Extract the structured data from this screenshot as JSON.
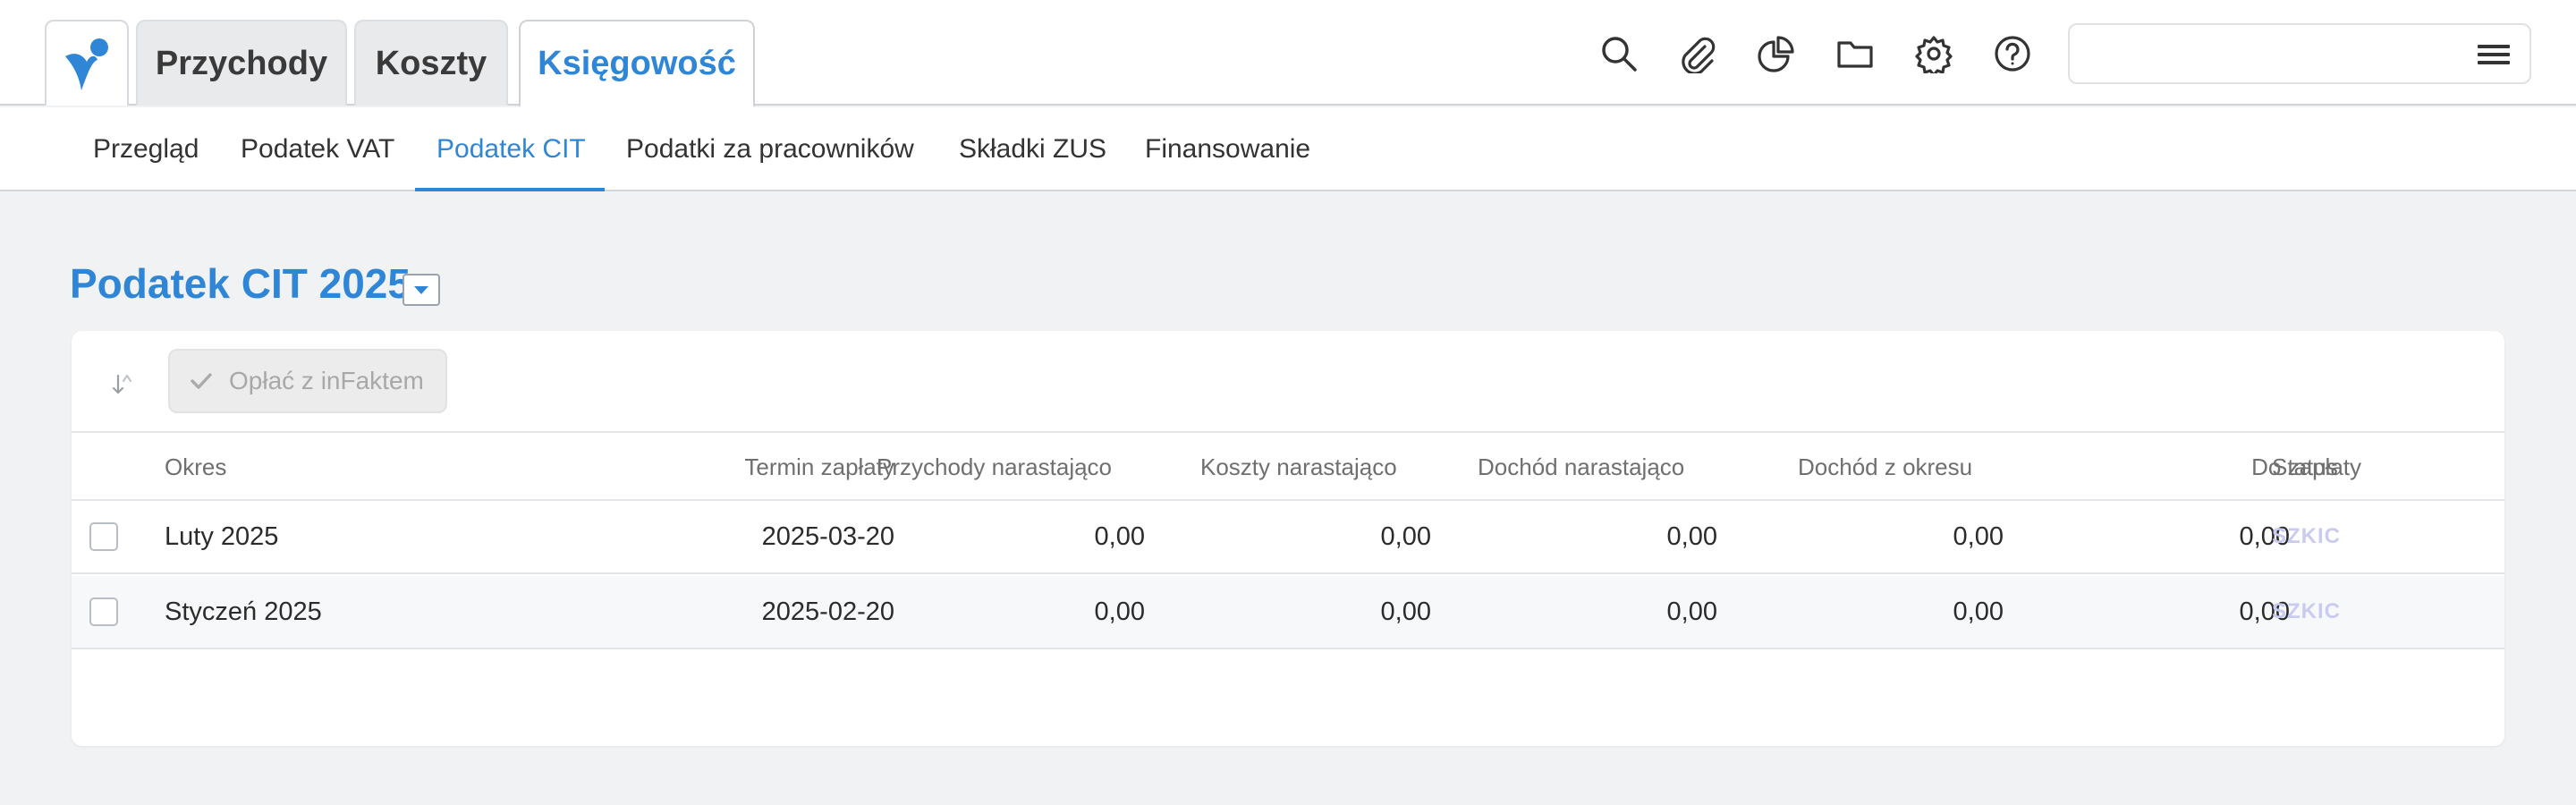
{
  "main_tabs": [
    {
      "label": "Przychody"
    },
    {
      "label": "Koszty"
    },
    {
      "label": "Księgowość"
    }
  ],
  "toolbar_icons": [
    "search-icon",
    "paperclip-icon",
    "pie-chart-icon",
    "folder-icon",
    "gear-icon",
    "help-icon"
  ],
  "search": {
    "placeholder": ""
  },
  "subnav": {
    "items": [
      {
        "label": "Przegląd"
      },
      {
        "label": "Podatek VAT"
      },
      {
        "label": "Podatek CIT"
      },
      {
        "label": "Podatki za pracowników"
      },
      {
        "label": "Składki ZUS"
      },
      {
        "label": "Finansowanie"
      }
    ],
    "active": "Podatek CIT"
  },
  "page": {
    "title": "Podatek CIT 2025"
  },
  "actions": {
    "pay_label": "Opłać z inFaktem"
  },
  "table": {
    "headers": {
      "okres": "Okres",
      "termin": "Termin zapłaty",
      "przychody": "Przychody narastająco",
      "koszty": "Koszty narastająco",
      "dochod_nar": "Dochód narastająco",
      "dochod_okres": "Dochód z okresu",
      "do_zaplaty": "Do zapłaty",
      "status": "Status"
    },
    "rows": [
      {
        "okres": "Luty 2025",
        "termin": "2025-03-20",
        "przychody": "0,00",
        "koszty": "0,00",
        "dochod_nar": "0,00",
        "dochod_okres": "0,00",
        "do_zaplaty": "0,00",
        "status": "SZKIC"
      },
      {
        "okres": "Styczeń 2025",
        "termin": "2025-02-20",
        "przychody": "0,00",
        "koszty": "0,00",
        "dochod_nar": "0,00",
        "dochod_okres": "0,00",
        "do_zaplaty": "0,00",
        "status": "SZKIC"
      }
    ]
  },
  "colors": {
    "accent": "#2f86d7",
    "status_draft": "#c9ccf0",
    "background": "#f1f2f4"
  }
}
